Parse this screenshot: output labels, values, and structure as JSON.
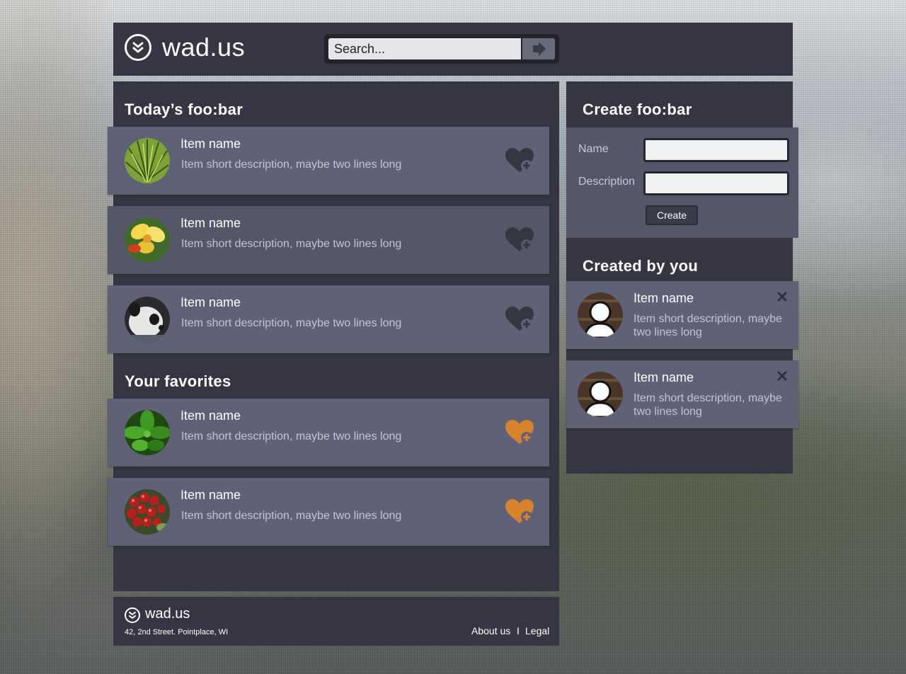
{
  "brand": {
    "logo_text": "wad.us"
  },
  "search": {
    "placeholder": "Search..."
  },
  "today": {
    "title": "Today’s foo:bar",
    "items": [
      {
        "name": "Item name",
        "description": "Item short description, maybe two lines long",
        "favorite": false,
        "thumb": "grass"
      },
      {
        "name": "Item name",
        "description": "Item short description, maybe two lines long",
        "favorite": false,
        "thumb": "flower"
      },
      {
        "name": "Item name",
        "description": "Item short description, maybe two lines long",
        "favorite": false,
        "thumb": "panda"
      }
    ]
  },
  "favorites": {
    "title": "Your favorites",
    "items": [
      {
        "name": "Item name",
        "description": "Item short description, maybe two lines long",
        "favorite": true,
        "thumb": "leaves"
      },
      {
        "name": "Item name",
        "description": "Item short description, maybe two lines long",
        "favorite": true,
        "thumb": "berries"
      }
    ]
  },
  "create": {
    "title": "Create foo:bar",
    "name_label": "Name",
    "name_value": "",
    "description_label": "Description",
    "description_value": "",
    "button_label": "Create"
  },
  "created": {
    "title": "Created by you",
    "items": [
      {
        "name": "Item name",
        "description": "Item short description, maybe two lines long",
        "thumb": "avatar"
      },
      {
        "name": "Item name",
        "description": "Item short description, maybe two lines long",
        "thumb": "avatar"
      }
    ]
  },
  "footer": {
    "logo_text": "wad.us",
    "address": "42, 2nd Street. Pointplace, WI",
    "about_label": "About us",
    "separator": "I",
    "legal_label": "Legal"
  },
  "colors": {
    "panel": "#353543",
    "card": "#5f6276",
    "heart_inactive": "#35363f",
    "heart_active": "#d9822b"
  },
  "icons": {
    "logo": "double-chevron-down-circle-icon",
    "search": "arrow-right-icon",
    "favorite": "heart-plus-icon",
    "remove": "close-icon"
  }
}
